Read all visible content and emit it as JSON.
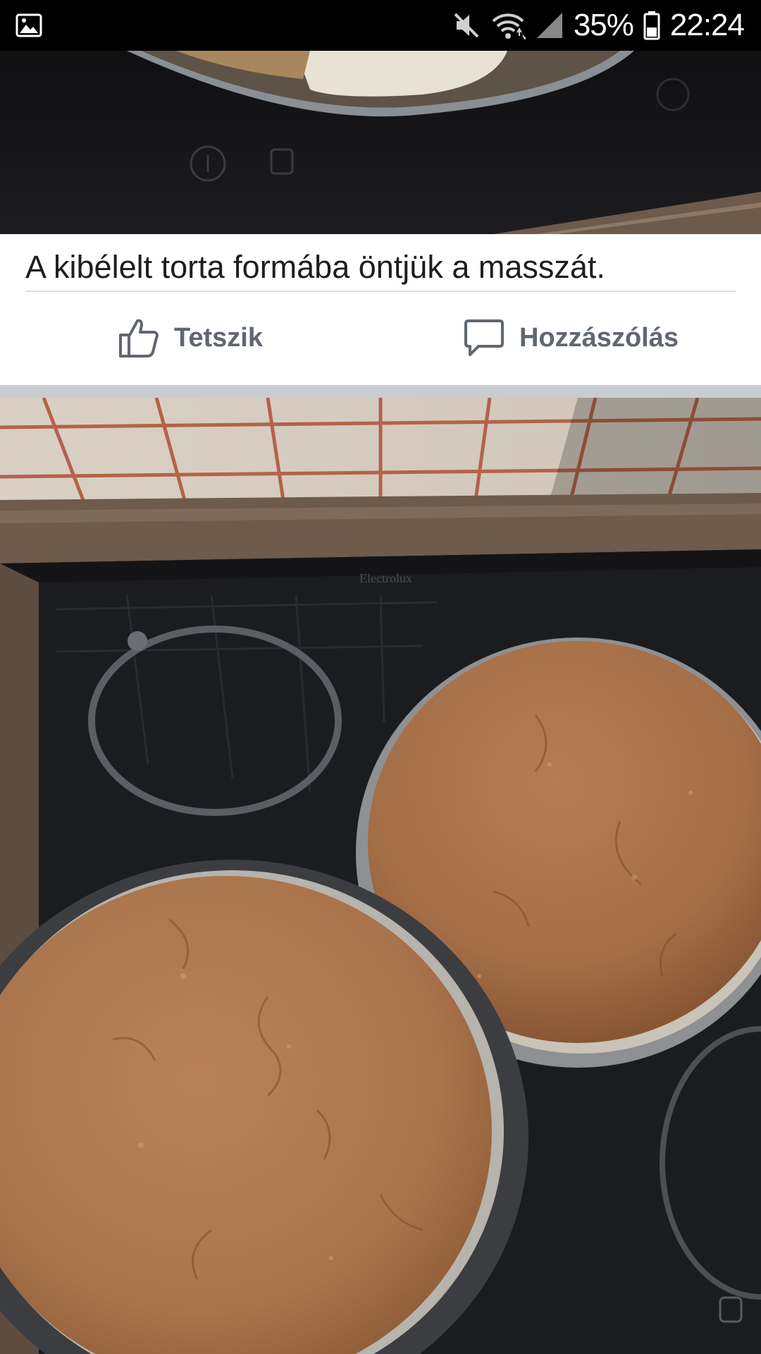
{
  "status_bar": {
    "battery_percent": "35%",
    "time": "22:24",
    "icons": [
      "image-notification-icon",
      "mute-icon",
      "wifi-icon",
      "signal-icon",
      "battery-icon"
    ]
  },
  "post": {
    "caption": "A kibélelt torta formába öntjük a masszát.",
    "actions": {
      "like_label": "Tetszik",
      "comment_label": "Hozzászólás"
    },
    "photos": [
      {
        "description_icon": "stove-pan-photo"
      },
      {
        "description_icon": "baked-cakes-photo",
        "stove_brand": "Electrolux"
      }
    ]
  },
  "colors": {
    "status_bar_bg": "#000000",
    "action_text": "#606770",
    "caption_text": "#1c1e21",
    "separator": "#c9ccd1"
  }
}
